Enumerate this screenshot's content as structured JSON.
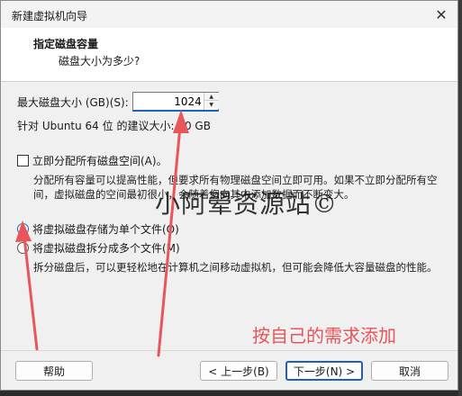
{
  "window": {
    "title": "新建虚拟机向导",
    "close_glyph": "✕"
  },
  "header": {
    "title": "指定磁盘容量",
    "subtitle": "磁盘大小为多少?"
  },
  "disk": {
    "size_label": "最大磁盘大小 (GB)(S):",
    "size_value": "1024",
    "suggest": "针对 Ubuntu 64 位 的建议大小: 20 GB"
  },
  "allocate": {
    "label": "立即分配所有磁盘空间(A)。",
    "checked": false,
    "description": "分配所有容量可以提高性能，但要求所有物理磁盘空间立即可用。如果不立即分配所有空间，虚拟磁盘的空间最初很小，会随着您向其中添加数据而不断变大。"
  },
  "split": {
    "single_label": "将虚拟磁盘存储为单个文件(O)",
    "multi_label": "将虚拟磁盘拆分成多个文件(M)",
    "selected": "single",
    "description": "拆分磁盘后，可以更轻松地在计算机之间移动虚拟机，但可能会降低大容量磁盘的性能。"
  },
  "footer": {
    "help": "帮助",
    "back": "< 上一步(B)",
    "next": "下一步(N) >",
    "cancel": "取消"
  },
  "overlay": {
    "watermark": "小阿翚资源站©",
    "note": "按自己的需求添加",
    "note_color": "#e8555a"
  },
  "colors": {
    "accent": "#1f5fbf"
  }
}
